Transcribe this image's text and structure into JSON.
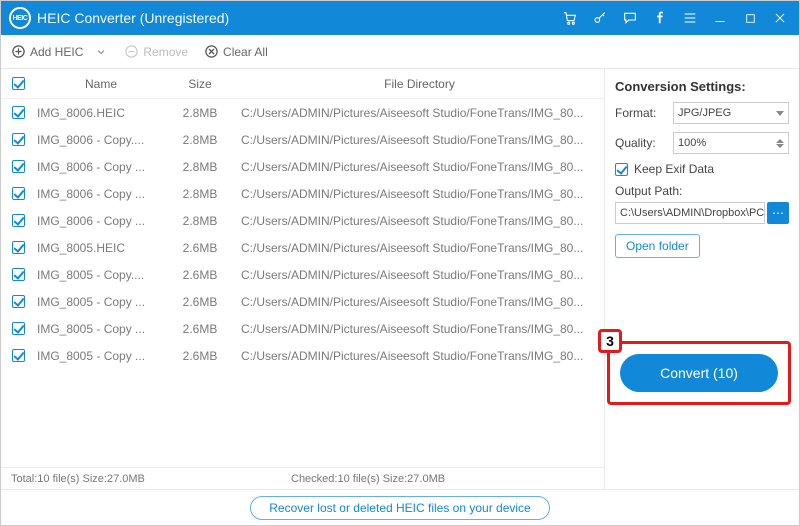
{
  "window": {
    "title": "HEIC Converter (Unregistered)"
  },
  "toolbar": {
    "add_label": "Add HEIC",
    "remove_label": "Remove",
    "clear_label": "Clear All"
  },
  "columns": {
    "name": "Name",
    "size": "Size",
    "dir": "File Directory"
  },
  "files": [
    {
      "name": "IMG_8006.HEIC",
      "size": "2.8MB",
      "dir": "C:/Users/ADMIN/Pictures/Aiseesoft Studio/FoneTrans/IMG_80..."
    },
    {
      "name": "IMG_8006 - Copy....",
      "size": "2.8MB",
      "dir": "C:/Users/ADMIN/Pictures/Aiseesoft Studio/FoneTrans/IMG_80..."
    },
    {
      "name": "IMG_8006 - Copy ...",
      "size": "2.8MB",
      "dir": "C:/Users/ADMIN/Pictures/Aiseesoft Studio/FoneTrans/IMG_80..."
    },
    {
      "name": "IMG_8006 - Copy ...",
      "size": "2.8MB",
      "dir": "C:/Users/ADMIN/Pictures/Aiseesoft Studio/FoneTrans/IMG_80..."
    },
    {
      "name": "IMG_8006 - Copy ...",
      "size": "2.8MB",
      "dir": "C:/Users/ADMIN/Pictures/Aiseesoft Studio/FoneTrans/IMG_80..."
    },
    {
      "name": "IMG_8005.HEIC",
      "size": "2.6MB",
      "dir": "C:/Users/ADMIN/Pictures/Aiseesoft Studio/FoneTrans/IMG_80..."
    },
    {
      "name": "IMG_8005 - Copy....",
      "size": "2.6MB",
      "dir": "C:/Users/ADMIN/Pictures/Aiseesoft Studio/FoneTrans/IMG_80..."
    },
    {
      "name": "IMG_8005 - Copy ...",
      "size": "2.6MB",
      "dir": "C:/Users/ADMIN/Pictures/Aiseesoft Studio/FoneTrans/IMG_80..."
    },
    {
      "name": "IMG_8005 - Copy ...",
      "size": "2.6MB",
      "dir": "C:/Users/ADMIN/Pictures/Aiseesoft Studio/FoneTrans/IMG_80..."
    },
    {
      "name": "IMG_8005 - Copy ...",
      "size": "2.6MB",
      "dir": "C:/Users/ADMIN/Pictures/Aiseesoft Studio/FoneTrans/IMG_80..."
    }
  ],
  "settings": {
    "heading": "Conversion Settings:",
    "format_label": "Format:",
    "format_value": "JPG/JPEG",
    "quality_label": "Quality:",
    "quality_value": "100%",
    "keep_exif_label": "Keep Exif Data",
    "output_label": "Output Path:",
    "output_value": "C:\\Users\\ADMIN\\Dropbox\\PC\\",
    "open_folder_label": "Open folder",
    "convert_label": "Convert (10)"
  },
  "status": {
    "total": "Total:10 file(s) Size:27.0MB",
    "checked": "Checked:10 file(s) Size:27.0MB"
  },
  "footer": {
    "recover_label": "Recover lost or deleted HEIC files on your device"
  },
  "annotation": {
    "step": "3"
  },
  "logo_text": "HEIC"
}
